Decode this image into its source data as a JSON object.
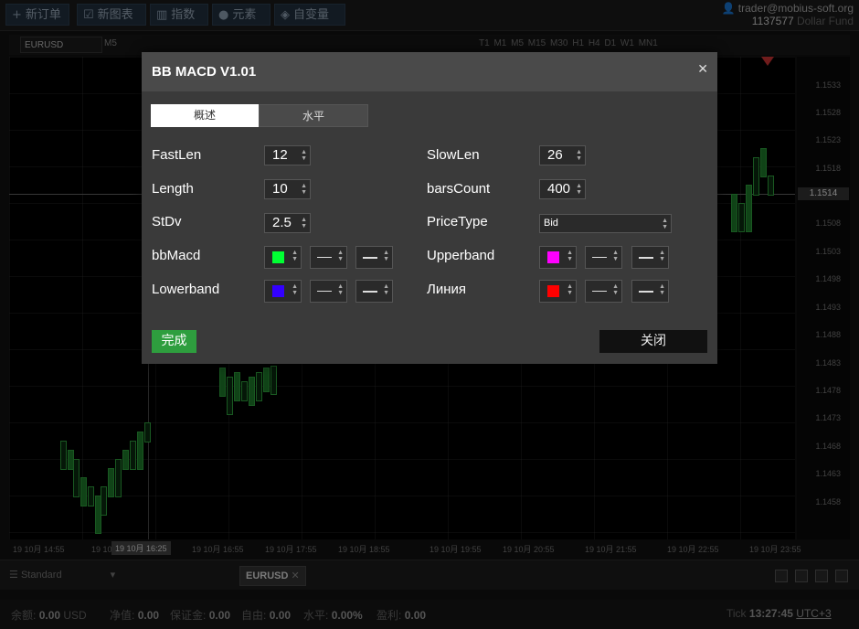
{
  "topbar": {
    "buttons": [
      "新订单",
      "新图表",
      "指数",
      "元素",
      "自变量"
    ],
    "account_email": "trader@mobius-soft.org",
    "account_id": "1137577",
    "fund_name": "Dollar Fund"
  },
  "chart": {
    "symbol": "EURUSD",
    "period": "M5",
    "timeframes": "T1 M1 M5 M15 M30 H1 H4 D1 W1 MN1",
    "prices": [
      "1.1533",
      "1.1528",
      "1.1523",
      "1.1518",
      "1.1508",
      "1.1503",
      "1.1498",
      "1.1493",
      "1.1488",
      "1.1483",
      "1.1478",
      "1.1473",
      "1.1468",
      "1.1463",
      "1.1458"
    ],
    "current_price": "1.1514",
    "times": [
      "19 10月 14:55",
      "19 10月 15:",
      "19 10月 16:55",
      "19 10月 17:55",
      "19 10月 18:55",
      "19 10月 19:55",
      "19 10月 20:55",
      "19 10月 21:55",
      "19 10月 22:55",
      "19 10月 23:55"
    ],
    "cursor_time": "19 10月 16:25"
  },
  "dialog": {
    "title": "BB MACD V1.01",
    "tabs": [
      "概述",
      "水平"
    ],
    "params": {
      "fastlen_label": "FastLen",
      "fastlen_value": "12",
      "slowlen_label": "SlowLen",
      "slowlen_value": "26",
      "length_label": "Length",
      "length_value": "10",
      "barscount_label": "barsCount",
      "barscount_value": "400",
      "stdv_label": "StDv",
      "stdv_value": "2.5",
      "pricetype_label": "PriceType",
      "pricetype_value": "Bid",
      "bbmacd_label": "bbMacd",
      "upperband_label": "Upperband",
      "lowerband_label": "Lowerband",
      "liniya_label": "Линия"
    },
    "colors": {
      "bbmacd": "#00ff33",
      "upperband": "#ff00ff",
      "lowerband": "#3300ff",
      "liniya": "#ff0000"
    },
    "ok_label": "完成",
    "close_label": "关闭"
  },
  "bottom": {
    "template": "Standard",
    "tab_symbol": "EURUSD"
  },
  "status": {
    "balance_label": "余额:",
    "balance_value": "0.00",
    "currency": "USD",
    "equity_label": "净值:",
    "equity_value": "0.00",
    "margin_label": "保证金:",
    "margin_value": "0.00",
    "free_label": "自由:",
    "free_value": "0.00",
    "level_label": "水平:",
    "level_value": "0.00%",
    "profit_label": "盈利:",
    "profit_value": "0.00",
    "tick_label": "Tick",
    "time": "13:27:45",
    "tz": "UTC+3"
  }
}
